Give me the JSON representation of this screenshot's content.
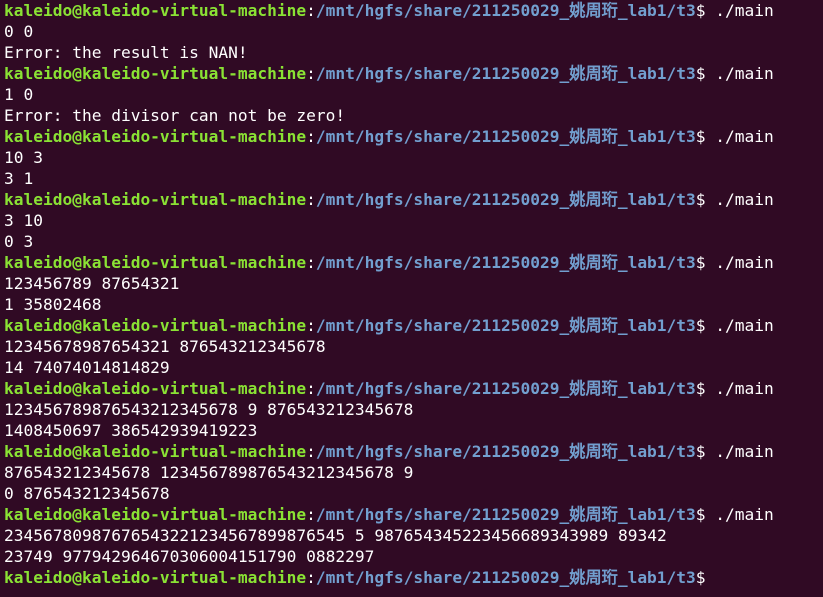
{
  "theme": {
    "background": "#300a24",
    "prompt_user_color": "#8ae234",
    "prompt_path_color": "#729fcf",
    "text_color": "#ffffff"
  },
  "prompt": {
    "user_host": "kaleido@kaleido-virtual-machine",
    "separator": ":",
    "path": "/mnt/hgfs/share/211250029_姚周珩_lab1/t3",
    "symbol": "$ "
  },
  "sessions": [
    {
      "command": "./main",
      "input": "0 0",
      "output": "Error: the result is NAN!"
    },
    {
      "command": "./main",
      "input": "1 0",
      "output": "Error: the divisor can not be zero!"
    },
    {
      "command": "./main",
      "input": "10 3",
      "output": "3 1"
    },
    {
      "command": "./main",
      "input": "3 10",
      "output": "0 3"
    },
    {
      "command": "./main",
      "input": "123456789 87654321",
      "output": "1 35802468"
    },
    {
      "command": "./main",
      "input": "12345678987654321 876543212345678",
      "output": "14 74074014814829"
    },
    {
      "command": "./main",
      "input": "123456789876543212345678 9 876543212345678",
      "output": "1408450697 386542939419223"
    },
    {
      "command": "./main",
      "input": "876543212345678 123456789876543212345678 9",
      "output": "0 876543212345678"
    },
    {
      "command": "./main",
      "input": "23456780987676543221234567899876545 5 987654345223456689343989 89342",
      "output": "23749 977942964670306004151790 0882297"
    }
  ],
  "final_prompt_command": ""
}
